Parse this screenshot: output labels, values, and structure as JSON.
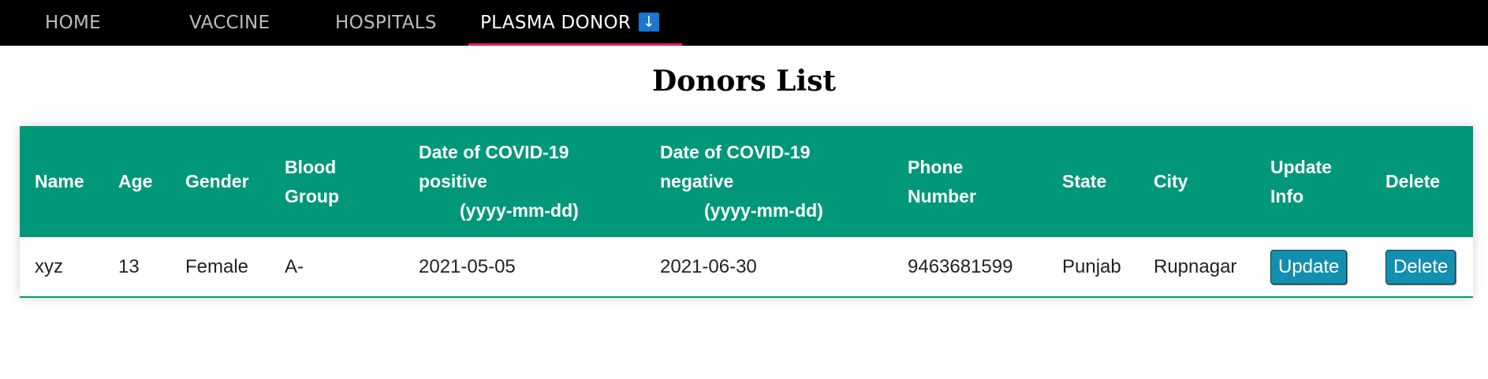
{
  "nav": {
    "items": [
      {
        "label": "HOME"
      },
      {
        "label": "VACCINE"
      },
      {
        "label": "HOSPITALS"
      },
      {
        "label": "PLASMA DONOR"
      }
    ],
    "active_download_icon": "↓",
    "accent_color": "#e91e63"
  },
  "page": {
    "title": "Donors List"
  },
  "table": {
    "header_color": "#009879",
    "columns": {
      "name": "Name",
      "age": "Age",
      "gender": "Gender",
      "blood_l1": "Blood",
      "blood_l2": "Group",
      "pos_l1": "Date of COVID-19",
      "pos_l2": "positive",
      "pos_l3": "(yyyy-mm-dd)",
      "neg_l1": "Date of COVID-19",
      "neg_l2": "negative",
      "neg_l3": "(yyyy-mm-dd)",
      "phone_l1": "Phone",
      "phone_l2": "Number",
      "state": "State",
      "city": "City",
      "update_l1": "Update",
      "update_l2": "Info",
      "delete": "Delete"
    },
    "rows": [
      {
        "name": "xyz",
        "age": "13",
        "gender": "Female",
        "blood_group": "A-",
        "positive_date": "2021-05-05",
        "negative_date": "2021-06-30",
        "phone": "9463681599",
        "state": "Punjab",
        "city": "Rupnagar",
        "update_label": "Update",
        "delete_label": "Delete"
      }
    ]
  }
}
